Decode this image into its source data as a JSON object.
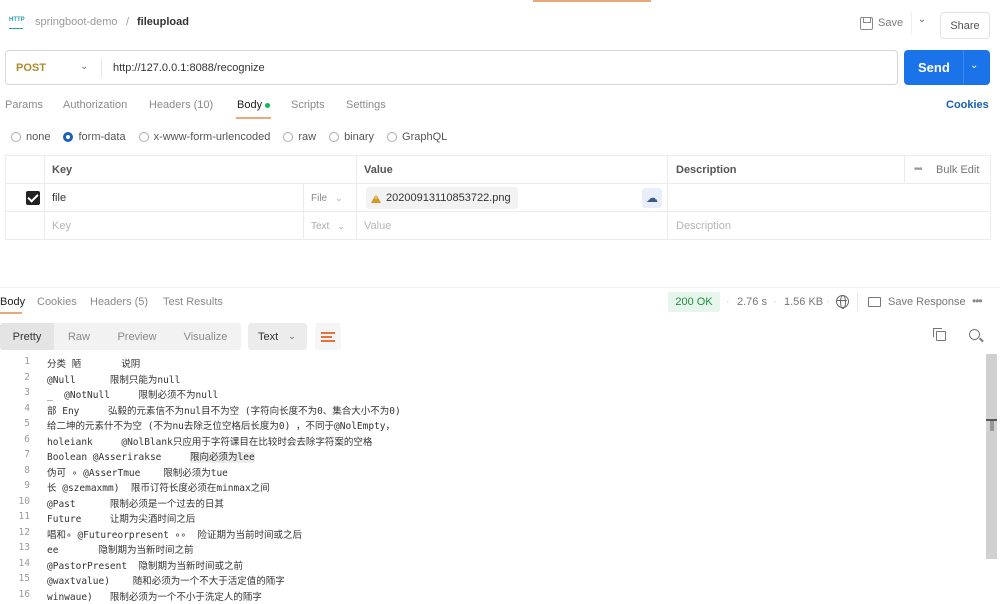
{
  "header": {
    "breadcrumb_parent": "springboot-demo",
    "breadcrumb_sep": "/",
    "breadcrumb_current": "fileupload",
    "http_icon_label": "HTTP",
    "save_label": "Save",
    "save_chevron": "⌄",
    "share_label": "Share"
  },
  "request": {
    "method": "POST",
    "method_chevron": "⌄",
    "url": "http://127.0.0.1:8088/recognize",
    "send_label": "Send",
    "send_chevron": "⌄"
  },
  "request_tabs": [
    {
      "label": "Params"
    },
    {
      "label": "Authorization"
    },
    {
      "label": "Headers (10)"
    },
    {
      "label": "Body",
      "active": true,
      "indicator": "green-dot"
    },
    {
      "label": "Scripts"
    },
    {
      "label": "Settings"
    }
  ],
  "cookies_link": "Cookies",
  "body_types": [
    {
      "label": "none",
      "checked": false
    },
    {
      "label": "form-data",
      "checked": true
    },
    {
      "label": "x-www-form-urlencoded",
      "checked": false
    },
    {
      "label": "raw",
      "checked": false
    },
    {
      "label": "binary",
      "checked": false
    },
    {
      "label": "GraphQL",
      "checked": false
    }
  ],
  "form_table": {
    "headers": {
      "key": "Key",
      "value": "Value",
      "description": "Description",
      "bulk_dots": "•••",
      "bulk_edit": "Bulk Edit"
    },
    "rows": [
      {
        "checked": true,
        "key": "file",
        "type": "File",
        "value": "20200913110853722.png",
        "value_icon": "warning-icon",
        "description": ""
      }
    ],
    "new_row": {
      "key_placeholder": "Key",
      "type": "Text",
      "value_placeholder": "Value",
      "description_placeholder": "Description"
    },
    "type_chevron": "⌄",
    "upload_icon": "☁"
  },
  "response": {
    "tabs": [
      {
        "label": "Body",
        "active": true
      },
      {
        "label": "Cookies"
      },
      {
        "label": "Headers (5)"
      },
      {
        "label": "Test Results"
      }
    ],
    "status": "200 OK",
    "time": "2.76 s",
    "size": "1.56 KB",
    "meta_dot": "·",
    "save_response_label": "Save Response",
    "more_label": "•••",
    "view_modes": [
      {
        "label": "Pretty",
        "active": true
      },
      {
        "label": "Raw"
      },
      {
        "label": "Preview"
      },
      {
        "label": "Visualize"
      }
    ],
    "format": "Text",
    "format_chevron": "⌄",
    "lines": [
      {
        "n": "1",
        "text": "分类 陋       说阴"
      },
      {
        "n": "2",
        "text": "@Null      限制只能为null"
      },
      {
        "n": "3",
        "text": "_  @NotNull     限制必须不为null"
      },
      {
        "n": "4",
        "text": "部 Eny     弘毅的元素信不为nul目不为空 (字符向长度不为0、集合大小不为0)"
      },
      {
        "n": "5",
        "text": "给二坤的元素什不为空 (不为nu去除乏位空格后长度为0) ，不同于@NolEmpty，"
      },
      {
        "n": "6",
        "text": "holeiank     @NolBlank只应用于字符课目在比较时会去除字符案的空格"
      },
      {
        "n": "7",
        "text": "Boolean @Asserirakse     ",
        "highlight": "限向必须为lee"
      },
      {
        "n": "8",
        "text": "伪可 ∘ @AsserTmue    限制必须为tue"
      },
      {
        "n": "9",
        "text": "长 @szemaxmm)  限币订符长度必须在minmax之间"
      },
      {
        "n": "10",
        "text": "@Past      限制必须是一个过去的日其"
      },
      {
        "n": "11",
        "text": "Future     让期为尖酒时间之后"
      },
      {
        "n": "12",
        "text": "唱和∘ @Futureorpresent ∘∘  险证期为当前时间或之后"
      },
      {
        "n": "13",
        "text": "ee       隐制期为当新时间之前"
      },
      {
        "n": "14",
        "text": "@PastorPresent  隐制期为当新时间或之前"
      },
      {
        "n": "15",
        "text": "@waxtvalue)    随和必须为一个不大于活定值的陑字"
      },
      {
        "n": "16",
        "text": "winwaue)   限制必须为一个不小于洗定人的陑字"
      }
    ]
  },
  "colors": {
    "accent_orange": "#e8a87c",
    "send_blue": "#1a73e8",
    "status_green": "#1e8e3e",
    "method_post": "#b08a2e"
  }
}
